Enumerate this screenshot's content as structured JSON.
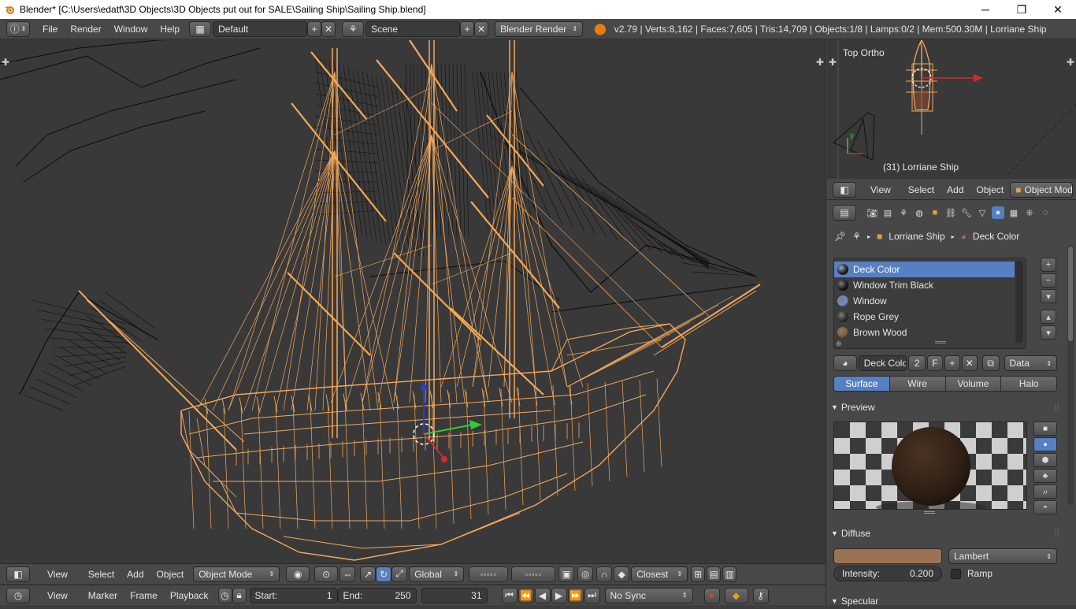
{
  "window": {
    "title": "Blender* [C:\\Users\\edatf\\3D Objects\\3D Objects put out for SALE\\Sailing Ship\\Sailing Ship.blend]",
    "minimize": "─",
    "maximize": "❐",
    "close": "✕"
  },
  "infobar": {
    "menus": [
      "File",
      "Render",
      "Window",
      "Help"
    ],
    "layout": "Default",
    "scene": "Scene",
    "engine": "Blender Render",
    "stats": "v2.79 | Verts:8,162 | Faces:7,605 | Tris:14,709 | Objects:1/8 | Lamps:0/2 | Mem:500.30M | Lorriane Ship"
  },
  "viewport_header": {
    "menus": [
      "View",
      "Select",
      "Add",
      "Object"
    ],
    "mode": "Object Mode",
    "orientation": "Global",
    "snap": "Closest"
  },
  "timeline": {
    "menus": [
      "View",
      "Marker",
      "Frame",
      "Playback"
    ],
    "start_label": "Start:",
    "start_value": "1",
    "end_label": "End:",
    "end_value": "250",
    "current_frame": "31",
    "sync": "No Sync"
  },
  "miniview": {
    "view_name": "Top Ortho",
    "object_label": "(31) Lorriane Ship",
    "axis_y": "y"
  },
  "right_header": {
    "menus": [
      "View",
      "Select",
      "Add",
      "Object"
    ],
    "mode": "Object Mode"
  },
  "properties": {
    "breadcrumb_object": "Lorriane Ship",
    "breadcrumb_material": "Deck Color",
    "materials": [
      {
        "name": "Deck Color",
        "color": "#2a1f18",
        "selected": true
      },
      {
        "name": "Window Trim Black",
        "color": "#1a1a1a",
        "selected": false
      },
      {
        "name": "Window",
        "color": "#6d8cc7",
        "selected": false
      },
      {
        "name": "Rope Grey",
        "color": "#2e2e2e",
        "selected": false
      },
      {
        "name": "Brown Wood",
        "color": "#8a5a32",
        "selected": false
      }
    ],
    "material_name": "Deck Color",
    "users": "2",
    "fake_user": "F",
    "link": "Data",
    "type_tabs": [
      "Surface",
      "Wire",
      "Volume",
      "Halo"
    ],
    "active_type": "Surface",
    "preview_label": "Preview",
    "diffuse_label": "Diffuse",
    "diffuse_color": "#9b7254",
    "diffuse_shader": "Lambert",
    "intensity_label": "Intensity:",
    "intensity_value": "0.200",
    "ramp_label": "Ramp",
    "specular_label": "Specular"
  },
  "colors": {
    "wire_selected": "#f5a85a",
    "wire_unselected": "#0c0c0c",
    "viewport_bg": "#393939",
    "accent": "#5680c2"
  }
}
